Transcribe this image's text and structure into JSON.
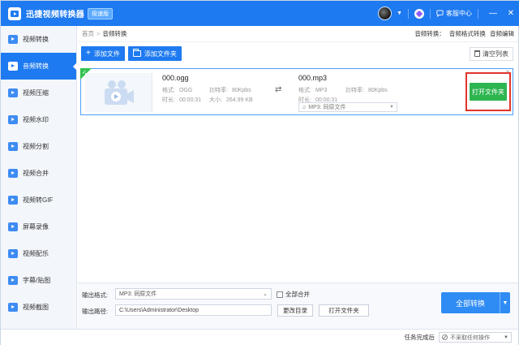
{
  "titlebar": {
    "title": "迅捷视频转换器",
    "edition": "极速版",
    "service_label": "客服中心",
    "minimize": "—",
    "close": "✕"
  },
  "sidebar": {
    "items": [
      {
        "label": "视频转换",
        "active": false
      },
      {
        "label": "音频转换",
        "active": true
      },
      {
        "label": "视频压缩",
        "active": false
      },
      {
        "label": "视频水印",
        "active": false
      },
      {
        "label": "视频分割",
        "active": false
      },
      {
        "label": "视频合并",
        "active": false
      },
      {
        "label": "视频转GIF",
        "active": false
      },
      {
        "label": "屏幕录像",
        "active": false
      },
      {
        "label": "视频配乐",
        "active": false
      },
      {
        "label": "字幕/贴图",
        "active": false
      },
      {
        "label": "视频截图",
        "active": false
      }
    ]
  },
  "breadcrumb": {
    "home": "首页",
    "sep": ">",
    "current": "音频转换",
    "links": [
      "音频转换：",
      "音频格式转换",
      "音频编辑"
    ]
  },
  "toolbar": {
    "add_file": "添加文件",
    "add_folder": "添加文件夹",
    "clear_list": "清空列表"
  },
  "file": {
    "source_name": "000.ogg",
    "src_format_label": "格式:",
    "src_format": "OGG",
    "src_bitrate_label": "比特率:",
    "src_bitrate": "80Kpbs",
    "src_duration_label": "时长:",
    "src_duration": "00:00:31",
    "src_size_label": "大小:",
    "src_size": "264.99 KB",
    "target_name": "000.mp3",
    "dst_format_label": "格式:",
    "dst_format": "MP3",
    "dst_bitrate_label": "比特率:",
    "dst_bitrate": "80Kpbs",
    "dst_duration_label": "时长:",
    "dst_duration": "00:00:31",
    "preset": "MP3: 同原文件",
    "open_folder": "打开文件夹"
  },
  "bottom": {
    "output_format_label": "输出格式:",
    "output_format": "MP3: 同原文件",
    "merge_label": "全部合并",
    "output_path_label": "输出路径:",
    "output_path": "C:\\Users\\Administrator\\Desktop",
    "change_dir": "更改目录",
    "open_folder": "打开文件夹",
    "convert_all": "全部转换"
  },
  "status": {
    "after_done_label": "任务完成后",
    "after_done_value": "不采取任何操作"
  },
  "colors": {
    "brand": "#1e7af0",
    "green": "#2db550",
    "highlight_box": "#e3342b"
  }
}
